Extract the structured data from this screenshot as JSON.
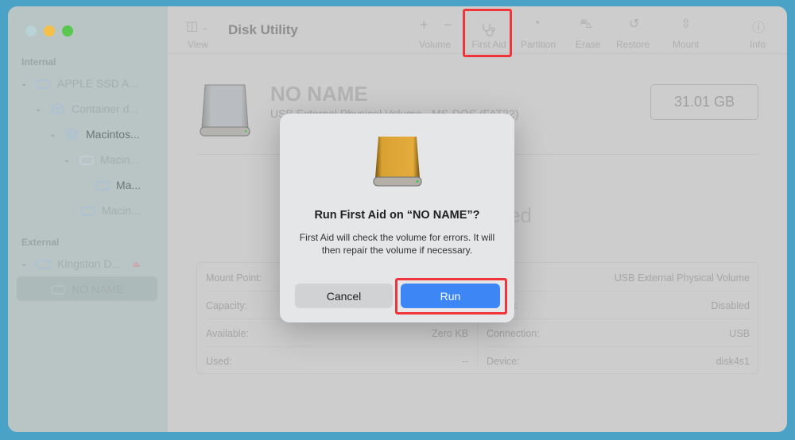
{
  "window": {
    "title": "Disk Utility"
  },
  "colors": {
    "accent": "#3d86f5",
    "highlight": "#f0343a"
  },
  "sidebar": {
    "internal_label": "Internal",
    "external_label": "External",
    "items": [
      {
        "label": "APPLE SSD A...",
        "icon": "internal-drive-icon"
      },
      {
        "label": "Container d...",
        "icon": "container-icon"
      },
      {
        "label": "Macintos...",
        "icon": "volume-group-icon"
      },
      {
        "label": "Macin...",
        "icon": "volume-icon"
      },
      {
        "label": "Ma...",
        "icon": "volume-icon"
      },
      {
        "label": "Macin...",
        "icon": "volume-icon"
      },
      {
        "label": "Kingston D...",
        "icon": "external-drive-icon"
      },
      {
        "label": "NO NAME",
        "icon": "volume-icon"
      }
    ]
  },
  "toolbar": {
    "view": "View",
    "volume": "Volume",
    "first_aid": "First Aid",
    "partition": "Partition",
    "erase": "Erase",
    "restore": "Restore",
    "mount": "Mount",
    "info": "Info"
  },
  "volume": {
    "name": "NO NAME",
    "subtitle": "USB External Physical Volume - MS-DOS (FAT32)",
    "size": "31.01 GB",
    "status_fragment": "ed"
  },
  "info": {
    "left": [
      {
        "label": "Mount Point:",
        "value": ""
      },
      {
        "label": "Capacity:",
        "value": ""
      },
      {
        "label": "Available:",
        "value": "Zero KB"
      },
      {
        "label": "Used:",
        "value": "--"
      }
    ],
    "right": [
      {
        "label": "",
        "value": "USB External Physical Volume"
      },
      {
        "label": "rs:",
        "value": "Disabled"
      },
      {
        "label": "Connection:",
        "value": "USB"
      },
      {
        "label": "Device:",
        "value": "disk4s1"
      }
    ]
  },
  "dialog": {
    "title": "Run First Aid on “NO NAME”?",
    "body": "First Aid will check the volume for errors. It will then repair the volume if necessary.",
    "cancel": "Cancel",
    "run": "Run"
  }
}
